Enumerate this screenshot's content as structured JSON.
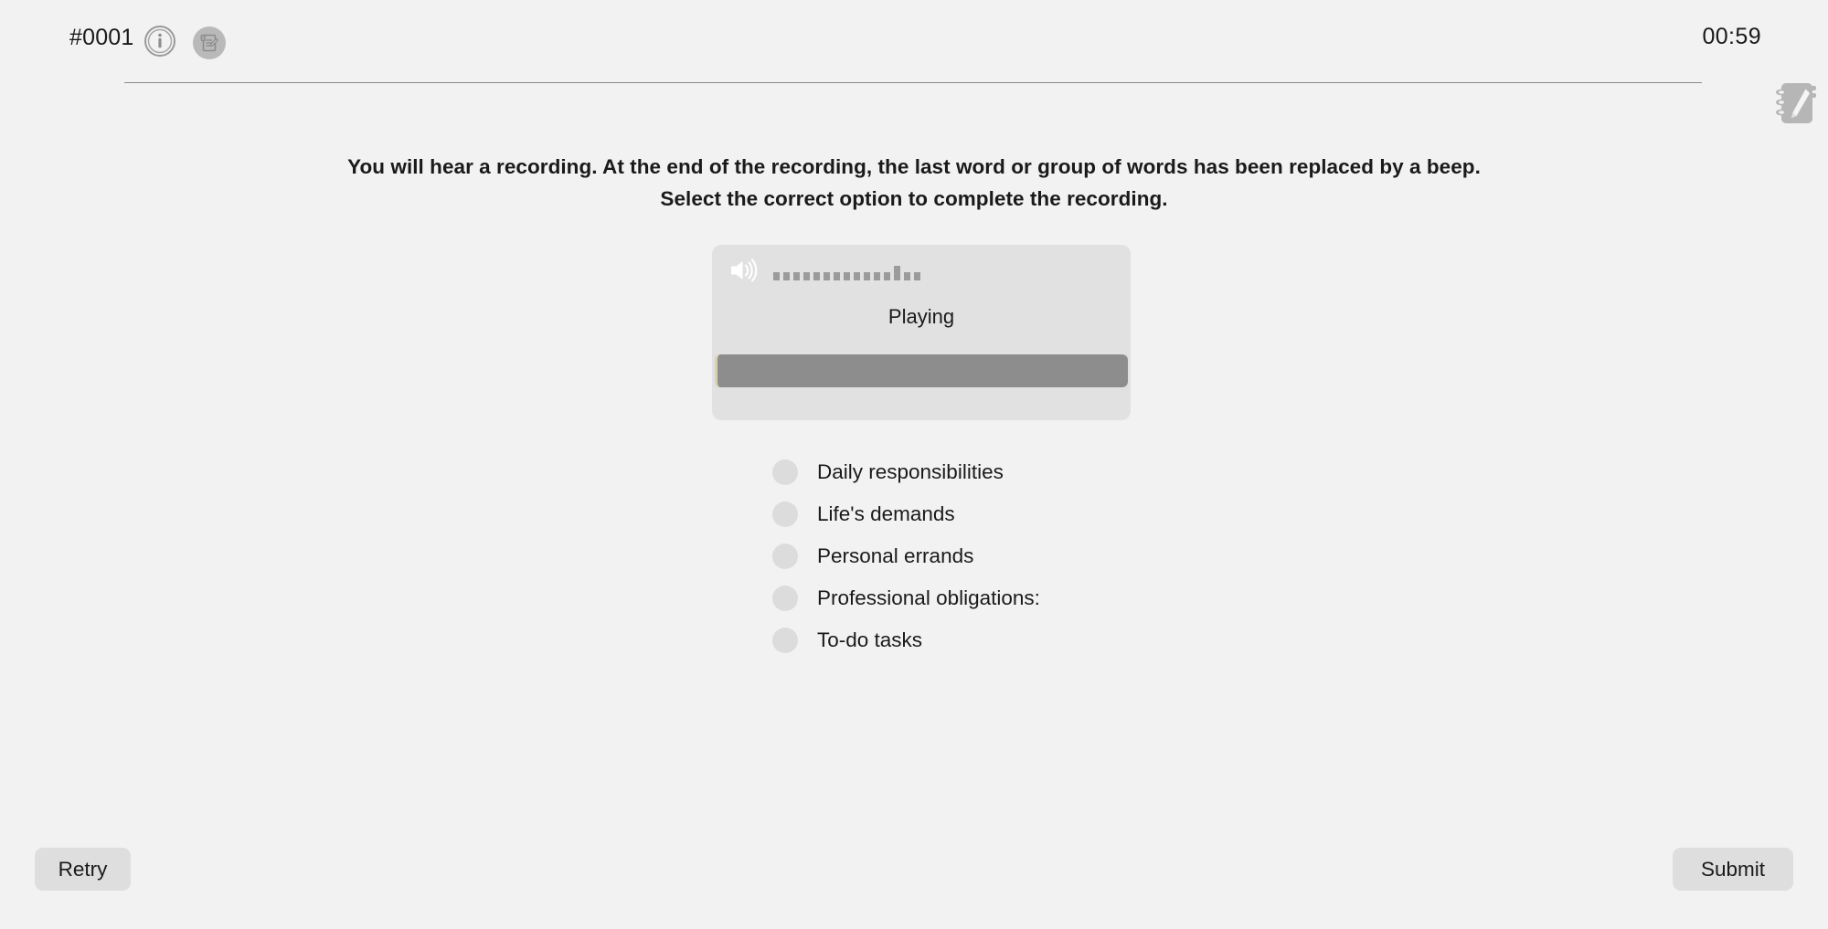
{
  "header": {
    "question_id": "#0001",
    "timer": "00:59",
    "info_icon": "info-icon",
    "notes_icon": "notepad-pencil-icon"
  },
  "floating": {
    "notepad_icon": "notepad-pencil-icon"
  },
  "instructions": {
    "line1": "You will hear a recording. At the end of the recording, the last word or group of words has been replaced by a beep.",
    "line2": "Select the correct option to complete the recording."
  },
  "player": {
    "speaker_icon": "speaker-volume-icon",
    "status": "Playing",
    "equalizer_bar_count": 15,
    "equalizer_heights": [
      9,
      9,
      9,
      9,
      9,
      9,
      9,
      9,
      9,
      9,
      9,
      9,
      16,
      9,
      9,
      9
    ],
    "progress_percent": 100,
    "colors": {
      "card_bg": "#e1e1e1",
      "progress_fill": "#8d8d8d",
      "progress_track": "#d2d2d2",
      "accent_edge": "#d9d2b0"
    }
  },
  "options": [
    {
      "label": "Daily responsibilities",
      "selected": false
    },
    {
      "label": "Life's demands",
      "selected": false
    },
    {
      "label": "Personal errands",
      "selected": false
    },
    {
      "label": "Professional obligations:",
      "selected": false
    },
    {
      "label": "To-do tasks",
      "selected": false
    }
  ],
  "footer": {
    "retry_label": "Retry",
    "submit_label": "Submit"
  },
  "colors": {
    "page_bg": "#f2f2f2",
    "text": "#1a1a1a",
    "divider": "#8a8a8a",
    "button_bg": "#dedede",
    "radio_bg": "#dcdcdc",
    "icon_gray": "#b9b9b9"
  }
}
